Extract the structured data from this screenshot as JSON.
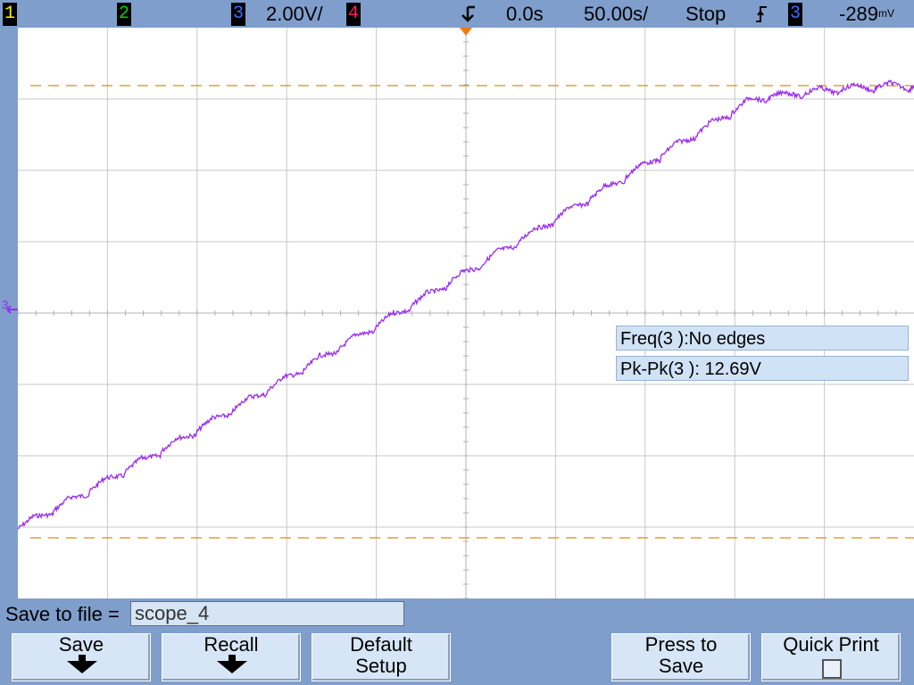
{
  "topbar": {
    "ch1": {
      "label": "1",
      "color": "#f2f200"
    },
    "ch2": {
      "label": "2",
      "color": "#00d000"
    },
    "ch3": {
      "label": "3",
      "color": "#3b6cff"
    },
    "ch3_scale": "2.00V/",
    "ch4": {
      "label": "4",
      "color": "#ff2060"
    },
    "trigger_pos_icon": "trigger-position-icon",
    "time_offset": "0.0s",
    "timebase": "50.00s/",
    "run_state": "Stop",
    "trigger_slope_icon": "rising-edge-icon",
    "trigger_source": "3",
    "trigger_level": "-289"
  },
  "waveform": {
    "channel": "3",
    "color": "#9a2cf0",
    "marker_label": "3",
    "cursor_color": "#e08a10"
  },
  "measurements": [
    {
      "text": "Freq(3 ):No edges"
    },
    {
      "text": "Pk-Pk(3 ): 12.69V"
    }
  ],
  "save": {
    "label": "Save to file =",
    "filename": "scope_4"
  },
  "softkeys": [
    {
      "line1": "Save",
      "line2": "",
      "icon": "down-arrow-icon"
    },
    {
      "line1": "Recall",
      "line2": "",
      "icon": "down-arrow-icon"
    },
    {
      "line1": "Default",
      "line2": "Setup",
      "icon": ""
    },
    {
      "line1": "Press to",
      "line2": "Save",
      "icon": ""
    },
    {
      "line1": "Quick Print",
      "line2": "",
      "icon": "checkbox-icon"
    }
  ]
}
